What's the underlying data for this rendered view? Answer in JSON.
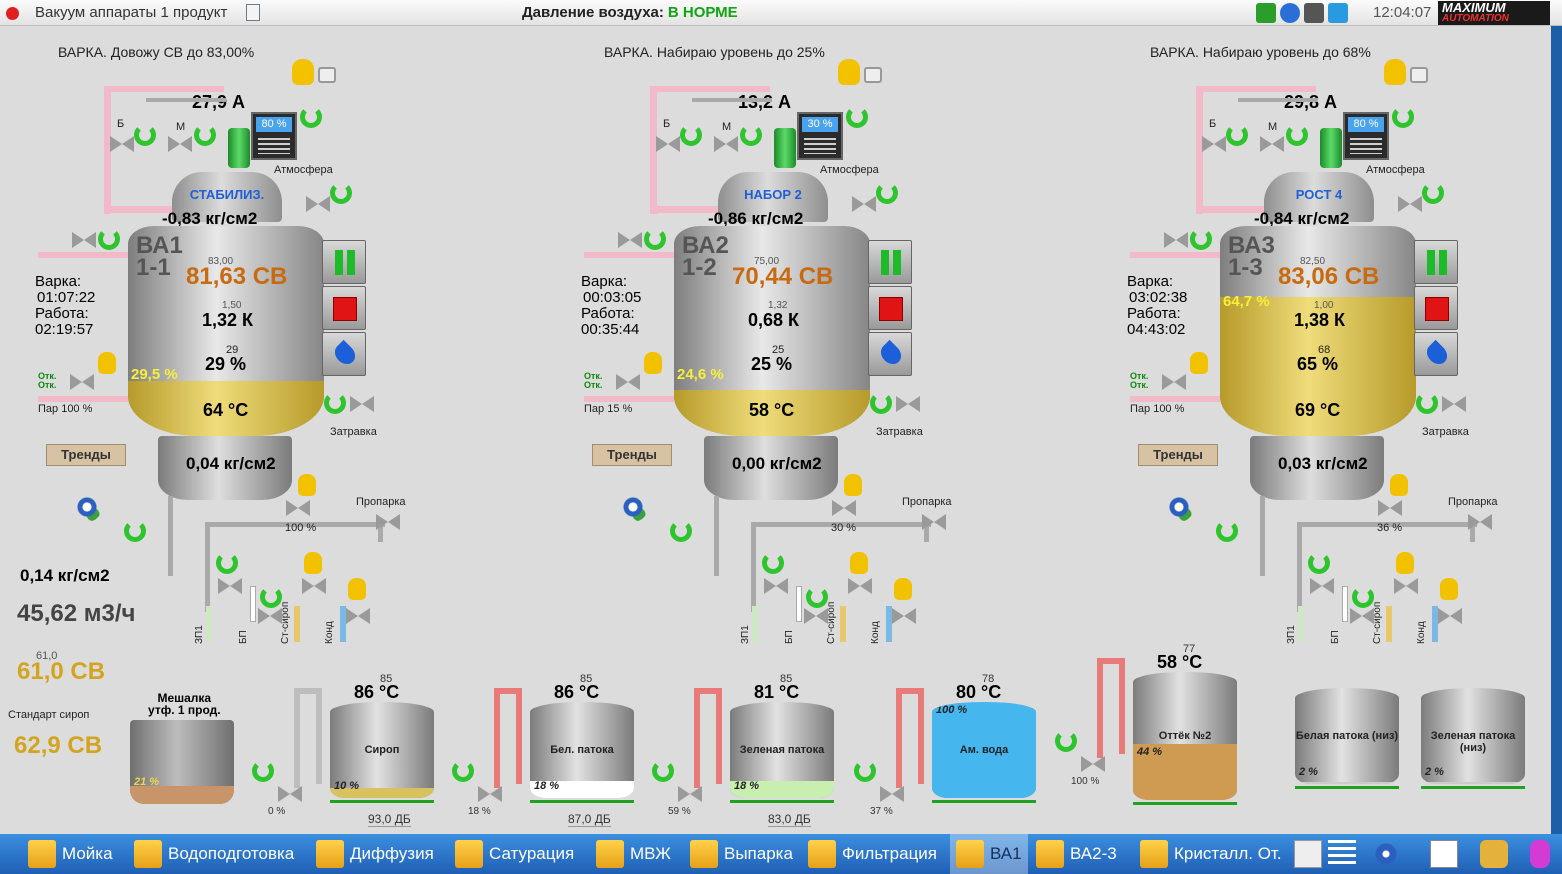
{
  "titlebar": {
    "app_title": "Вакуум аппараты 1 продукт",
    "air_label": "Давление воздуха:",
    "air_value": "В НОРМЕ",
    "clock": "12:04:07",
    "logo_line1": "MAXIMUM",
    "logo_line2": "AUTOMATION"
  },
  "units": [
    {
      "status": "ВАРКА. Довожу СВ до  83,00%",
      "current": "27,9 А",
      "display_pct": "80 %",
      "mode": "СТАБИЛИЗ.",
      "vacuum": "-0,83 кг/см2",
      "name1": "ВА1",
      "name2": "1-1",
      "sv_set": "83,00",
      "sv": "81,63 СВ",
      "k_set": "1,50",
      "k": "1,32 К",
      "level_set": "29",
      "level": "29 %",
      "fill_level_pct": "29,5 %",
      "temp": "64 °С",
      "lower_pressure": "0,04 кг/см2",
      "varka_label": "Варка:",
      "varka_time": "01:07:22",
      "rabota_label": "Работа:",
      "rabota_time": "02:19:57",
      "otk1": "Отк.",
      "otk2": "Отк.",
      "steam": "Пар  100 %",
      "atm": "Атмосфера",
      "zatravka": "Затравка",
      "proparka": "Пропарка",
      "valve_pct": "100 %",
      "b_label": "Б",
      "m_label": "М",
      "trend_label": "Тренды",
      "pipes": [
        "ЗП1",
        "БП",
        "Ст-сироп",
        "Конд"
      ],
      "fill_fraction": 0.26
    },
    {
      "status": "ВАРКА. Набираю уровень до    25%",
      "current": "13,2 А",
      "display_pct": "30 %",
      "mode": "НАБОР 2",
      "vacuum": "-0,86 кг/см2",
      "name1": "ВА2",
      "name2": "1-2",
      "sv_set": "75,00",
      "sv": "70,44 СВ",
      "k_set": "1,32",
      "k": "0,68 К",
      "level_set": "25",
      "level": "25 %",
      "fill_level_pct": "24,6 %",
      "temp": "58 °С",
      "lower_pressure": "0,00 кг/см2",
      "varka_label": "Варка:",
      "varka_time": "00:03:05",
      "rabota_label": "Работа:",
      "rabota_time": "00:35:44",
      "otk1": "Отк.",
      "otk2": "Отк.",
      "steam": "Пар   15 %",
      "atm": "Атмосфера",
      "zatravka": "Затравка",
      "proparka": "Пропарка",
      "valve_pct": "30 %",
      "b_label": "Б",
      "m_label": "М",
      "trend_label": "Тренды",
      "pipes": [
        "ЗП1",
        "БП",
        "Ст-сироп",
        "Конд"
      ],
      "fill_fraction": 0.22
    },
    {
      "status": "ВАРКА. Набираю уровень до    68%",
      "current": "29,8 А",
      "display_pct": "80 %",
      "mode": "РОСТ 4",
      "vacuum": "-0,84 кг/см2",
      "name1": "ВА3",
      "name2": "1-3",
      "sv_set": "82,50",
      "sv": "83,06 СВ",
      "k_set": "1,00",
      "k": "1,38 К",
      "level_set": "68",
      "level": "65 %",
      "fill_level_pct": "64,7 %",
      "temp": "69 °С",
      "lower_pressure": "0,03 кг/см2",
      "varka_label": "Варка:",
      "varka_time": "03:02:38",
      "rabota_label": "Работа:",
      "rabota_time": "04:43:02",
      "otk1": "Отк.",
      "otk2": "Отк.",
      "steam": "Пар  100 %",
      "atm": "Атмосфера",
      "zatravka": "Затравка",
      "proparka": "Пропарка",
      "valve_pct": "36 %",
      "b_label": "Б",
      "m_label": "М",
      "trend_label": "Тренды",
      "pipes": [
        "ЗП1",
        "БП",
        "Ст-сироп",
        "Конд"
      ],
      "fill_fraction": 0.66
    }
  ],
  "left_panel": {
    "pressure": "0,14 кг/см2",
    "flow": "45,62 м3/ч",
    "sv_set": "61,0",
    "sv": "61,0 СВ",
    "standard_label": "Стандарт сироп",
    "standard_value": "62,9 СВ",
    "mixer_title1": "Мешалка",
    "mixer_title2": "утф. 1 прод.",
    "mixer_pct": "21 %",
    "mixer_fill": 0.21
  },
  "small_tanks": [
    {
      "set": "85",
      "temp": "86 °С",
      "name": "Сироп",
      "pct": "10 %",
      "valve_pct": "0 %",
      "db": "93,0 ДБ",
      "color": "#d8c260",
      "fill": 0.1
    },
    {
      "set": "85",
      "temp": "86 °С",
      "name": "Бел. патока",
      "pct": "18 %",
      "valve_pct": "18 %",
      "db": "87,0 ДБ",
      "color": "#ffffff",
      "fill": 0.18
    },
    {
      "set": "85",
      "temp": "81 °С",
      "name": "Зеленая патока",
      "pct": "18 %",
      "valve_pct": "59 %",
      "db": "83,0 ДБ",
      "color": "#c9efb0",
      "fill": 0.18
    },
    {
      "set": "78",
      "temp": "80 °С",
      "name": "Ам. вода",
      "pct": "100 %",
      "valve_pct": "37 %",
      "db": "",
      "color": "#45b6ee",
      "fill": 1.0
    },
    {
      "set": "77",
      "temp": "58 °С",
      "name": "Оттёк №2",
      "pct": "44 %",
      "valve_pct": "100 %",
      "db": "",
      "color": "#cf9a52",
      "fill": 0.44
    },
    {
      "set": "",
      "temp": "",
      "name": "Белая патока (низ)",
      "pct": "2 %",
      "valve_pct": "",
      "db": "",
      "color": "#cccccc",
      "fill": 0.02
    },
    {
      "set": "",
      "temp": "",
      "name": "Зеленая патока (низ)",
      "pct": "2 %",
      "valve_pct": "",
      "db": "",
      "color": "#cccccc",
      "fill": 0.02
    }
  ],
  "taskbar": {
    "items": [
      "Мойка",
      "Водоподготовка",
      "Диффузия",
      "Сатурация",
      "МВЖ",
      "Выпарка",
      "Фильтрация",
      "ВА1",
      "ВА2-3",
      "Кристалл. От."
    ],
    "active": "ВА1"
  }
}
